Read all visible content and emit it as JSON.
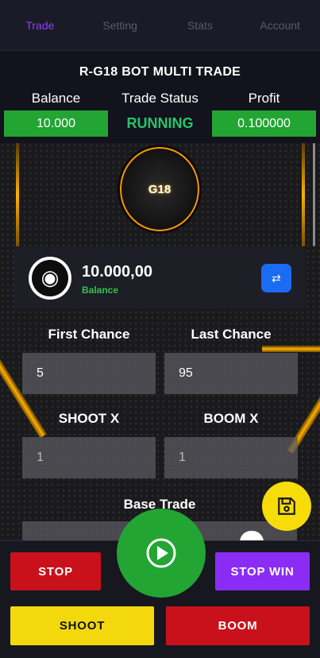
{
  "tabs": [
    "Trade",
    "Setting",
    "Stats",
    "Account"
  ],
  "header": {
    "title": "R-G18 BOT MULTI TRADE",
    "balance_label": "Balance",
    "status_label": "Trade Status",
    "profit_label": "Profit",
    "balance_value": "10.000",
    "status_value": "RUNNING",
    "profit_value": "0.100000"
  },
  "logo": {
    "text": "G18"
  },
  "balance_card": {
    "amount": "10.000,00",
    "sub_label": "Balance",
    "refresh_icon": "⇄"
  },
  "fields": {
    "first_chance_label": "First Chance",
    "last_chance_label": "Last Chance",
    "first_chance_value": "5",
    "last_chance_value": "95",
    "shoot_x_label": "SHOOT X",
    "boom_x_label": "BOOM X",
    "shoot_x_value": "1",
    "boom_x_value": "1",
    "base_trade_label": "Base Trade"
  },
  "buttons": {
    "stop": "STOP",
    "stop_win": "STOP WIN",
    "shoot": "SHOOT",
    "boom": "BOOM"
  },
  "colors": {
    "accent_purple": "#8b3dff",
    "green": "#22a533",
    "red": "#c8111b",
    "yellow": "#f7dc0a",
    "blue": "#1b6cf2"
  }
}
